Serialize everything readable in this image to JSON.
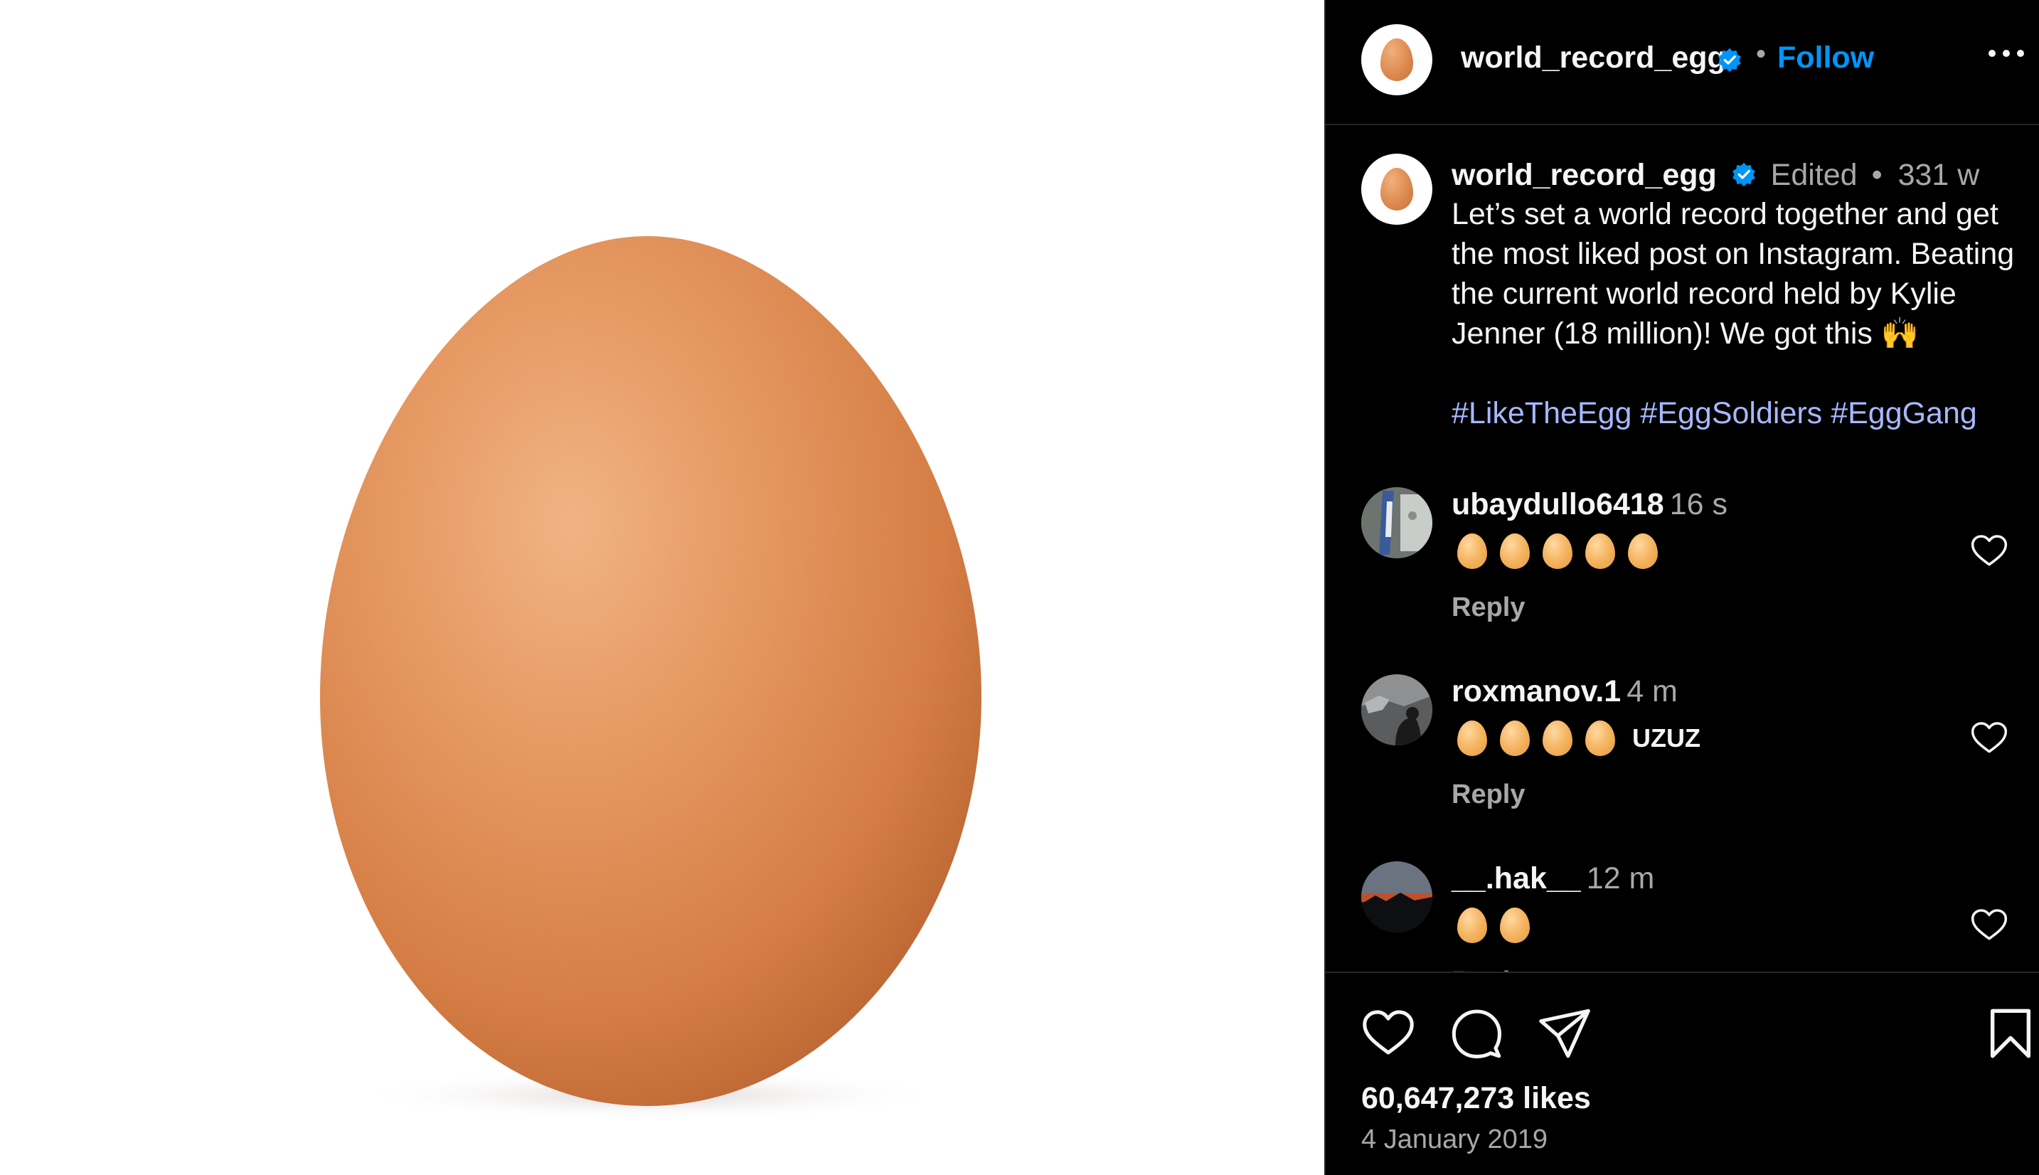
{
  "post": {
    "image_alt": "egg",
    "username": "world_record_egg",
    "follow_label": "Follow",
    "separator": "•",
    "more_label": "..."
  },
  "caption": {
    "username": "world_record_egg",
    "edited": "Edited",
    "dot": "•",
    "time": "331 w",
    "text": "Let’s set a world record together and get the most liked post on Instagram. Beating the current world record held by Kylie Jenner (18 million)! We got this 🙌",
    "hashtags": [
      "#LikeTheEgg",
      "#EggSoldiers",
      "#EggGang"
    ]
  },
  "comments": [
    {
      "username": "ubaydullo6418",
      "time": "16 s",
      "egg_count": 5,
      "text": "",
      "reply": "Reply"
    },
    {
      "username": "roxmanov.1",
      "time": "4 m",
      "egg_count": 4,
      "text": "UZUZ",
      "reply": "Reply"
    },
    {
      "username": "__.hak__",
      "time": "12 m",
      "egg_count": 2,
      "text": "",
      "reply": "Reply"
    }
  ],
  "footer": {
    "likes": "60,647,273 likes",
    "date": "4 January 2019"
  },
  "colors": {
    "accent": "#0095f6",
    "hashtag": "#a7b8ff",
    "panel_bg": "#000000",
    "egg": "#e08e58"
  },
  "icons": {
    "like": "heart-icon",
    "comment": "comment-bubble-icon",
    "share": "send-icon",
    "save": "bookmark-icon",
    "verified": "verified-badge-icon"
  }
}
